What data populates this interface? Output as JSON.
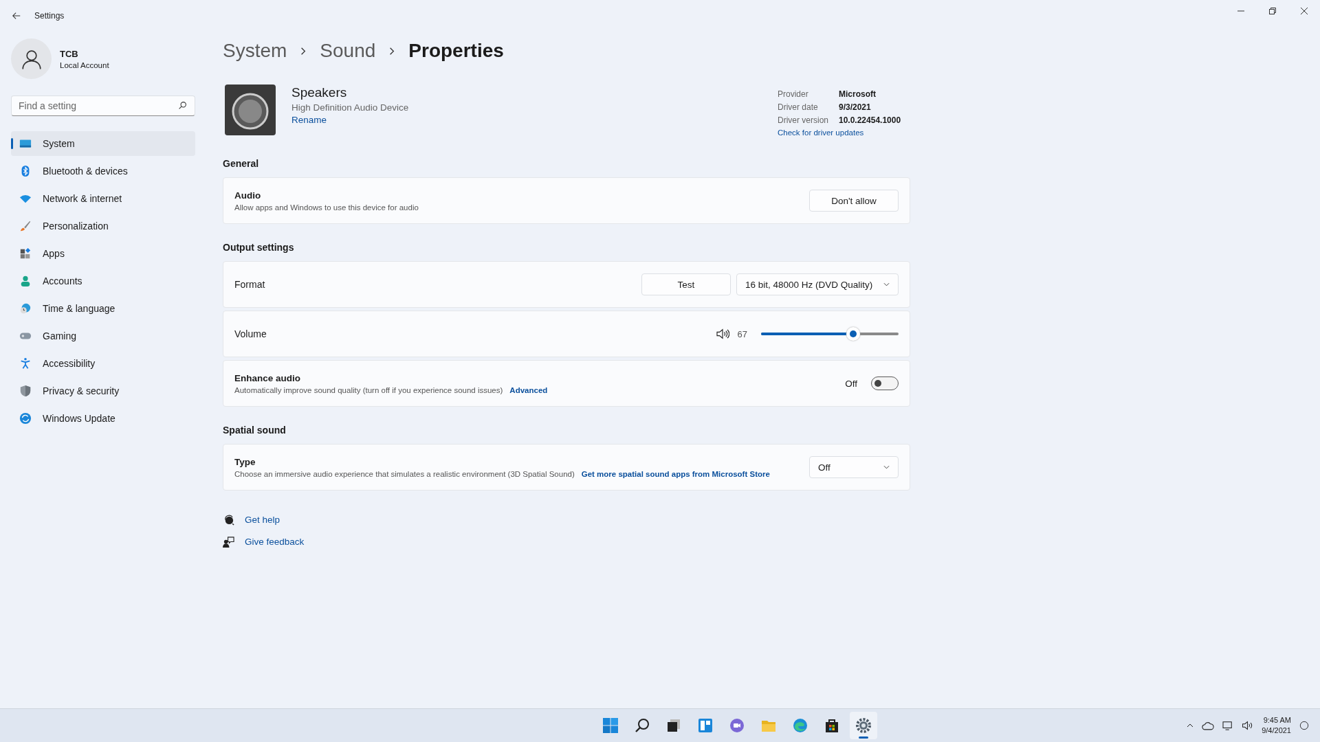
{
  "window": {
    "title": "Settings"
  },
  "account": {
    "name": "TCB",
    "type": "Local Account"
  },
  "search": {
    "placeholder": "Find a setting"
  },
  "sidebar": {
    "items": [
      {
        "label": "System",
        "selected": true
      },
      {
        "label": "Bluetooth & devices",
        "selected": false
      },
      {
        "label": "Network & internet",
        "selected": false
      },
      {
        "label": "Personalization",
        "selected": false
      },
      {
        "label": "Apps",
        "selected": false
      },
      {
        "label": "Accounts",
        "selected": false
      },
      {
        "label": "Time & language",
        "selected": false
      },
      {
        "label": "Gaming",
        "selected": false
      },
      {
        "label": "Accessibility",
        "selected": false
      },
      {
        "label": "Privacy & security",
        "selected": false
      },
      {
        "label": "Windows Update",
        "selected": false
      }
    ]
  },
  "breadcrumb": [
    "System",
    "Sound",
    "Properties"
  ],
  "device": {
    "name": "Speakers",
    "description": "High Definition Audio Device",
    "rename": "Rename"
  },
  "driver": {
    "rows": [
      {
        "label": "Provider",
        "value": "Microsoft"
      },
      {
        "label": "Driver date",
        "value": "9/3/2021"
      },
      {
        "label": "Driver version",
        "value": "10.0.22454.1000"
      }
    ],
    "link": "Check for driver updates"
  },
  "sections": [
    {
      "title": "General",
      "cards": [
        {
          "kind": "button",
          "title": "Audio",
          "description": "Allow apps and Windows to use this device for audio",
          "button": "Don't allow"
        }
      ]
    },
    {
      "title": "Output settings",
      "cards": [
        {
          "kind": "format",
          "title": "Format",
          "button": "Test",
          "dropdown": "16 bit, 48000 Hz (DVD Quality)"
        },
        {
          "kind": "slider",
          "title": "Volume",
          "reading": "67",
          "level": 0.67
        },
        {
          "kind": "toggle",
          "title": "Enhance audio",
          "description": "Automatically improve sound quality (turn off if you experience sound issues)",
          "link": "Advanced",
          "state_label": "Off",
          "on": false
        }
      ]
    },
    {
      "title": "Spatial sound",
      "cards": [
        {
          "kind": "dropdown",
          "title": "Type",
          "description": "Choose an immersive audio experience that simulates a realistic environment (3D Spatial Sound)",
          "link": "Get more spatial sound apps from Microsoft Store",
          "dropdown": "Off"
        }
      ]
    }
  ],
  "help_links": [
    {
      "label": "Get help"
    },
    {
      "label": "Give feedback"
    }
  ],
  "taskbar": {
    "apps": [
      {
        "selected": false
      },
      {
        "selected": false
      },
      {
        "selected": false
      },
      {
        "selected": false
      },
      {
        "selected": false
      },
      {
        "selected": false
      },
      {
        "selected": false
      },
      {
        "selected": false
      },
      {
        "selected": true
      }
    ],
    "time": "9:45 AM",
    "date": "9/4/2021"
  }
}
